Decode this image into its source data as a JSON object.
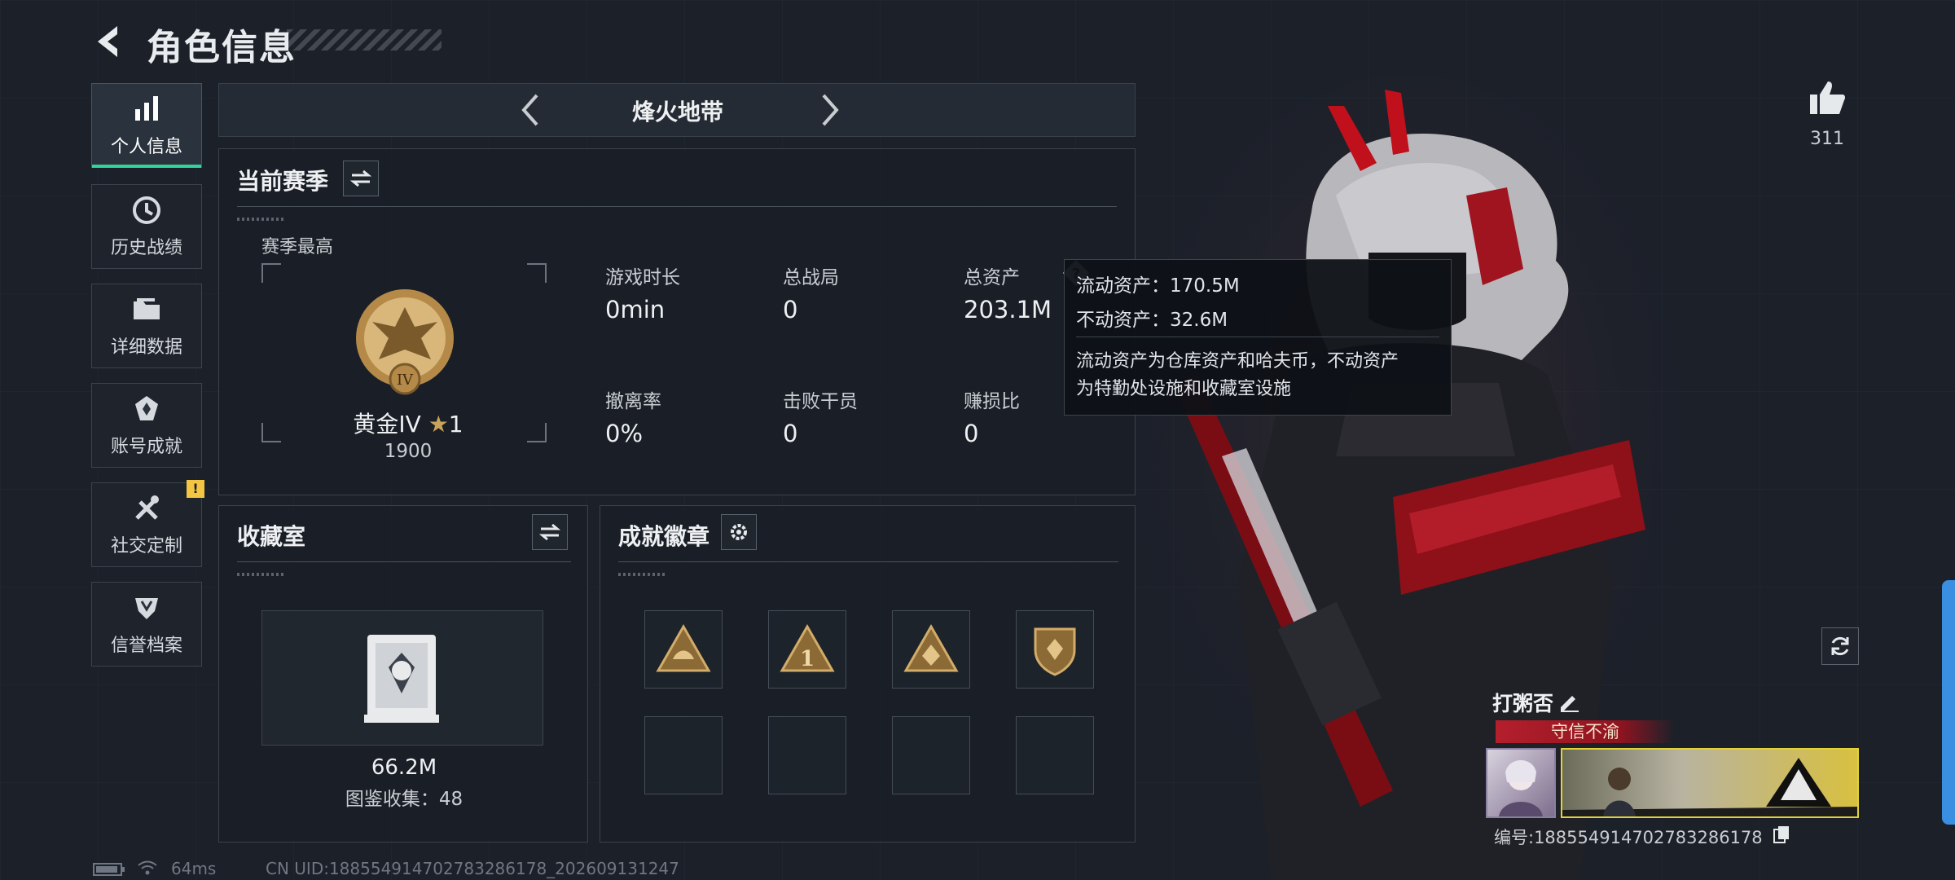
{
  "header": {
    "title": "角色信息"
  },
  "sidebar": {
    "items": [
      {
        "label": "个人信息",
        "icon": "bar-chart-icon",
        "active": true
      },
      {
        "label": "历史战绩",
        "icon": "clock-icon"
      },
      {
        "label": "详细数据",
        "icon": "folder-icon"
      },
      {
        "label": "账号成就",
        "icon": "achievement-icon"
      },
      {
        "label": "社交定制",
        "icon": "tools-icon",
        "badge": "!"
      },
      {
        "label": "信誉档案",
        "icon": "shield-icon"
      }
    ]
  },
  "mode": {
    "title": "烽火地带"
  },
  "season": {
    "title": "当前赛季",
    "best_label": "赛季最高",
    "rank_name": "黄金IV",
    "rank_star": "1",
    "rank_score": "1900",
    "rank_emblem_text": "IV",
    "stats": [
      {
        "label": "游戏时长",
        "value": "0min"
      },
      {
        "label": "总战局",
        "value": "0"
      },
      {
        "label": "总资产",
        "value": "203.1M"
      },
      {
        "label": "撤离率",
        "value": "0%"
      },
      {
        "label": "击败干员",
        "value": "0"
      },
      {
        "label": "赚损比",
        "value": "0"
      }
    ]
  },
  "tooltip": {
    "liquid": "流动资产：170.5M",
    "fixed": "不动资产：32.6M",
    "desc_line1": "流动资产为仓库资产和哈夫币，不动资产",
    "desc_line2": "为特勤处设施和收藏室设施"
  },
  "collection": {
    "title": "收藏室",
    "value": "66.2M",
    "count": "图鉴收集：48"
  },
  "achievements": {
    "title": "成就徽章",
    "badge_number": "1"
  },
  "profile": {
    "likes": "311",
    "name": "打粥否",
    "rank_title": "守信不渝",
    "uid_label": "编号:18855491470278328617​8"
  },
  "footer": {
    "ping": "64ms",
    "uid": "CN UID:18855491470278328617​8_202609131247"
  },
  "colors": {
    "accent_green": "#33d39a",
    "badge_gold": "#c9a35c",
    "rank_red": "#b51f2c",
    "warning": "#f3c543"
  }
}
